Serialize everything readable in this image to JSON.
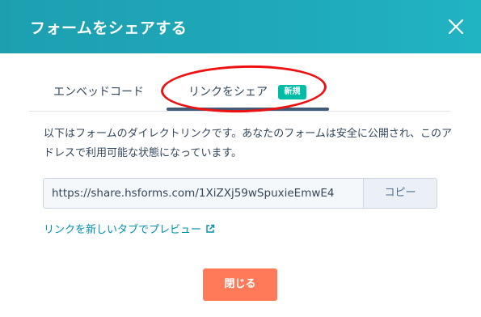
{
  "modal": {
    "title": "フォームをシェアする",
    "close_icon": "close-icon"
  },
  "tabs": [
    {
      "label": "エンベッドコード",
      "active": false
    },
    {
      "label": "リンクをシェア",
      "active": true,
      "badge": "新規"
    }
  ],
  "description": "以下はフォームのダイレクトリンクです。あなたのフォームは安全に公開され、このアドレスで利用可能な状態になっています。",
  "share_link": {
    "url": "https://share.hsforms.com/1XiZXj59wSpuxieEmwE4",
    "copy_label": "コピー"
  },
  "preview": {
    "label": "リンクを新しいタブでプレビュー",
    "icon": "external-link-icon"
  },
  "footer": {
    "close_label": "閉じる"
  },
  "colors": {
    "header": "#1fa9ba",
    "accent_button": "#ff7a59",
    "badge": "#00bda5",
    "link": "#0091ae",
    "annotation": "#ee1111"
  }
}
